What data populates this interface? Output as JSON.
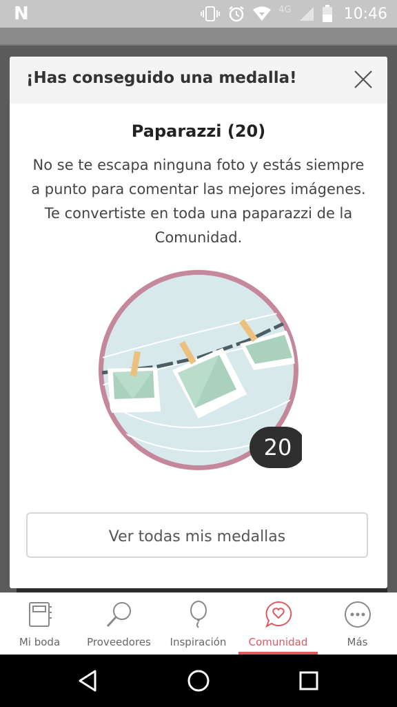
{
  "status_bar": {
    "time": "10:46",
    "network": "4G"
  },
  "modal": {
    "header_title": "¡Has conseguido una medalla!",
    "medal_title": "Paparazzi (20)",
    "description": "No se te escapa ninguna foto y estás siempre a punto para comentar las mejores imágenes. Te convertiste en toda una paparazzi de la Comunidad.",
    "badge_count": "20",
    "view_all_label": "Ver todas mis medallas"
  },
  "tab_bar": {
    "items": [
      {
        "label": "Mi boda",
        "icon": "notebook-icon",
        "active": false
      },
      {
        "label": "Proveedores",
        "icon": "search-icon",
        "active": false
      },
      {
        "label": "Inspiración",
        "icon": "balloon-icon",
        "active": false
      },
      {
        "label": "Comunidad",
        "icon": "chat-heart-icon",
        "active": true
      },
      {
        "label": "Más",
        "icon": "more-dots-icon",
        "active": false
      }
    ]
  },
  "colors": {
    "accent": "#e0575d",
    "medal_ring": "#c4879b",
    "medal_bg": "#d8e9ec",
    "photo_green": "#a9d1bd",
    "clip": "#ecc07e"
  }
}
